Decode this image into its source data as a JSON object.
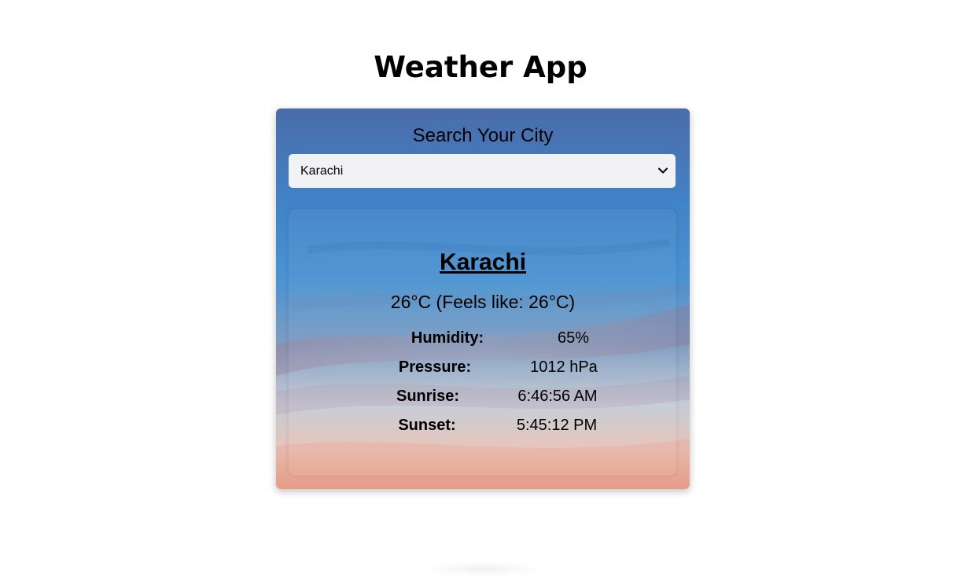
{
  "app": {
    "title": "Weather App"
  },
  "search": {
    "heading": "Search Your City",
    "selected_city": "Karachi"
  },
  "weather": {
    "city": "Karachi",
    "temperature_line": "26°C (Feels like: 26°C)",
    "stats": [
      {
        "label": "Humidity:",
        "value": "65%"
      },
      {
        "label": "Pressure:",
        "value": "1012 hPa"
      },
      {
        "label": "Sunrise:",
        "value": "6:46:56 AM"
      },
      {
        "label": "Sunset:",
        "value": "5:45:12 PM"
      }
    ]
  },
  "colors": {
    "sky_top": "#4a6fae",
    "sky_mid": "#3f8fd0",
    "sky_low": "#c9cfd8",
    "sky_sunset": "#f0a48a",
    "select_bg": "#f1f2f4"
  },
  "icons": {
    "dropdown": "chevron-down-icon"
  }
}
